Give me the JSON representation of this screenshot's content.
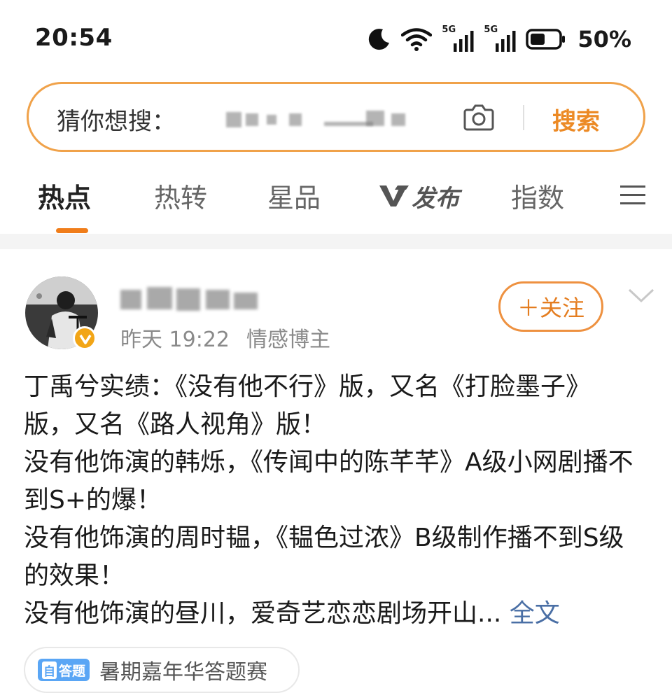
{
  "status_bar": {
    "time": "20:54",
    "network_1": "5G",
    "network_2": "5G",
    "battery": "50%",
    "icons": [
      "moon-icon",
      "wifi-icon",
      "signal-icon",
      "signal-icon",
      "battery-icon"
    ]
  },
  "search": {
    "label": "猜你想搜：",
    "button": "搜索",
    "icons": [
      "camera-icon"
    ]
  },
  "tabs": [
    {
      "label": "热点",
      "active": true
    },
    {
      "label": "热转"
    },
    {
      "label": "星品"
    },
    {
      "label": "发布",
      "prefix_logo": "V"
    },
    {
      "label": "指数"
    }
  ],
  "post": {
    "time": "昨天 19:22",
    "author_tag": "情感博主",
    "follow_label": "＋关注",
    "text": "丁禹兮实绩：《没有他不行》版，又名《打脸墨子》版，又名《路人视角》版！\n没有他饰演的韩烁，《传闻中的陈芊芊》A级小网剧播不到S+的爆！\n没有他饰演的周时韫，《韫色过浓》B级制作播不到S级的效果！\n没有他饰演的昼川，爱奇艺恋恋剧场开山...",
    "full_text_link": "全文",
    "topic": {
      "badge_1": "自",
      "badge_2": "答题",
      "label": "暑期嘉年华答题赛"
    }
  },
  "colors": {
    "accent_orange": "#ec8a25",
    "search_border": "#f0a24a",
    "link_blue": "#4a6fa5",
    "verified_badge": "#f2a516",
    "topic_blue": "#5aa6f5"
  }
}
